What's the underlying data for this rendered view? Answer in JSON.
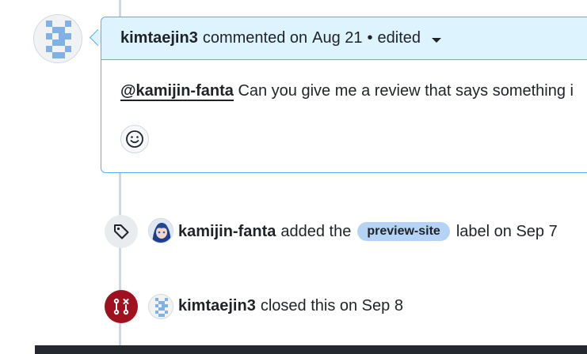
{
  "comment": {
    "author": "kimtaejin3",
    "action": "commented on",
    "date": "Aug 21",
    "bullet": "•",
    "edited": "edited",
    "mention": "@kamijin-fanta",
    "body": "Can you give me a review that says something i"
  },
  "events": [
    {
      "icon": "tag-icon",
      "actor": "kamijin-fanta",
      "action": "added the",
      "label": "preview-site",
      "suffix": "label on Sep 7"
    },
    {
      "icon": "git-pull-request-closed-icon",
      "actor": "kimtaejin3",
      "action": "closed this on Sep 8"
    }
  ],
  "colors": {
    "header_bg": "#ddf4ff",
    "border_accent": "#54aeff",
    "closed_red": "#a0111f",
    "label_bg": "#b5d4f5",
    "identicon_blue": "#7fb0e6"
  }
}
